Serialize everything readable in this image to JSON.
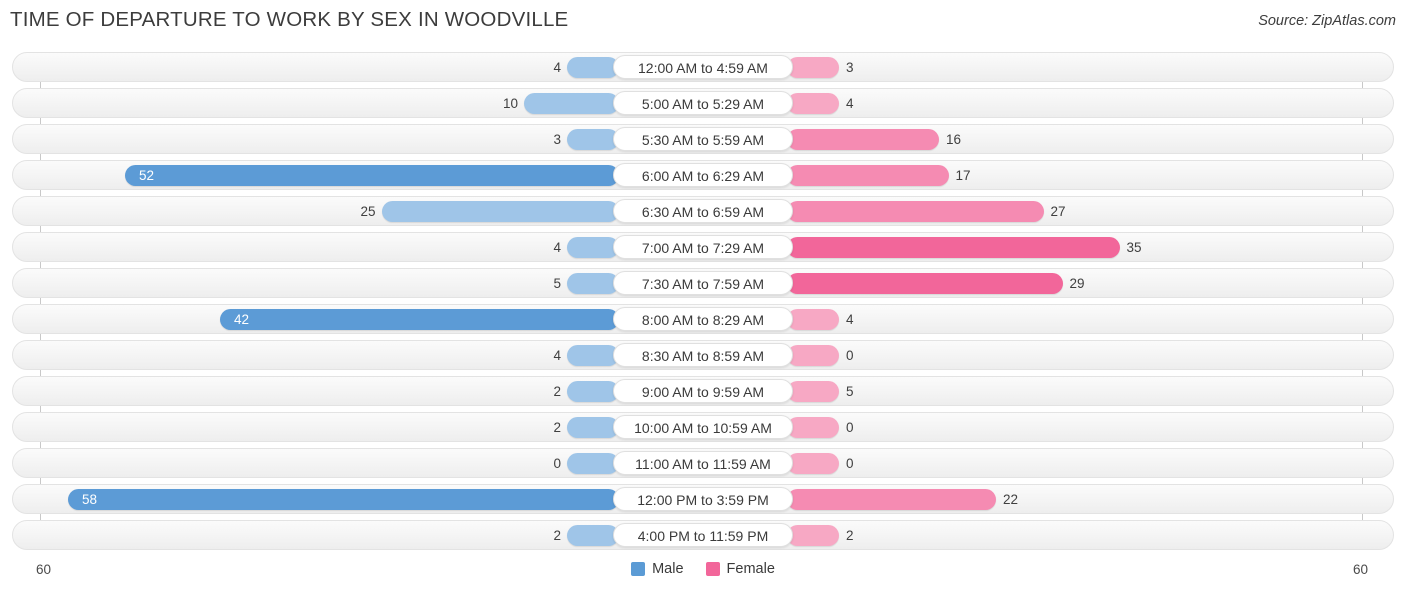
{
  "header": {
    "title": "TIME OF DEPARTURE TO WORK BY SEX IN WOODVILLE",
    "source": "Source: ZipAtlas.com"
  },
  "axis": {
    "left_end_label": "60",
    "right_end_label": "60",
    "max": 60
  },
  "legend": {
    "items": [
      {
        "label": "Male",
        "color": "#5b9bd5"
      },
      {
        "label": "Female",
        "color": "#f2669a"
      }
    ]
  },
  "colors": {
    "male_light": "#9fc5e8",
    "male_dark": "#5c9bd6",
    "female_light": "#f7a8c4",
    "female_mid": "#f58bb2",
    "female_dark": "#f2669a",
    "track": "#f4f4f4",
    "axis": "#c8c8c8"
  },
  "chart_data": {
    "type": "bar",
    "title": "TIME OF DEPARTURE TO WORK BY SEX IN WOODVILLE",
    "subtitle": "",
    "orientation": "horizontal-diverging",
    "xlabel": "",
    "ylabel": "",
    "xlim": [
      60,
      60
    ],
    "grid": false,
    "legend_position": "bottom-center",
    "categories": [
      "12:00 AM to 4:59 AM",
      "5:00 AM to 5:29 AM",
      "5:30 AM to 5:59 AM",
      "6:00 AM to 6:29 AM",
      "6:30 AM to 6:59 AM",
      "7:00 AM to 7:29 AM",
      "7:30 AM to 7:59 AM",
      "8:00 AM to 8:29 AM",
      "8:30 AM to 8:59 AM",
      "9:00 AM to 9:59 AM",
      "10:00 AM to 10:59 AM",
      "11:00 AM to 11:59 AM",
      "12:00 PM to 3:59 PM",
      "4:00 PM to 11:59 PM"
    ],
    "series": [
      {
        "name": "Male",
        "values": [
          4,
          10,
          3,
          52,
          25,
          4,
          5,
          42,
          4,
          2,
          2,
          0,
          58,
          2
        ]
      },
      {
        "name": "Female",
        "values": [
          3,
          4,
          16,
          17,
          27,
          35,
          29,
          4,
          0,
          5,
          0,
          0,
          22,
          2
        ]
      }
    ]
  }
}
